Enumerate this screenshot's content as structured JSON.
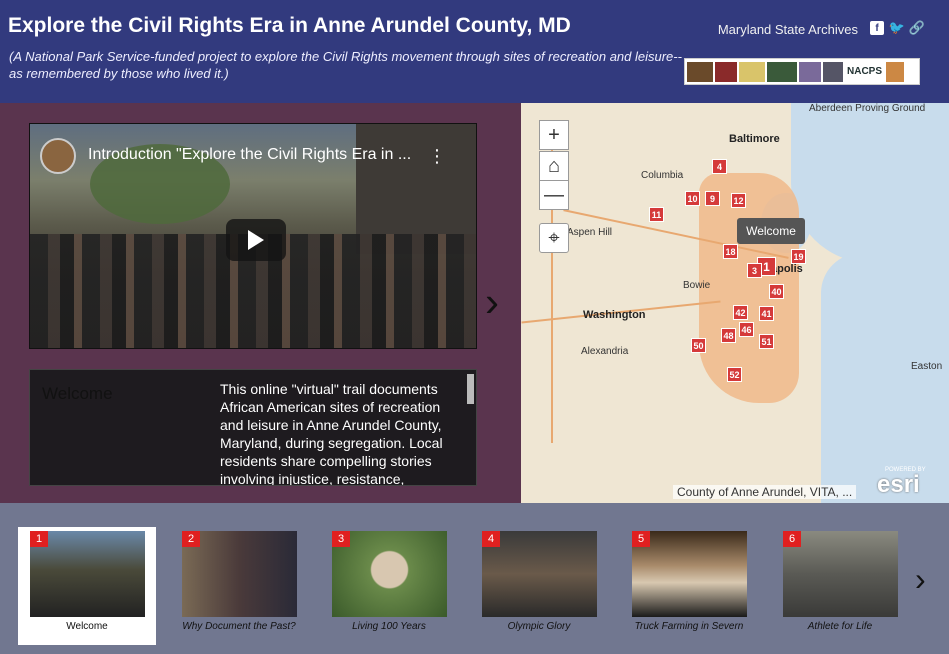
{
  "header": {
    "title": "Explore the Civil Rights Era in Anne Arundel County, MD",
    "subtitle": "(A National Park Service-funded project to explore the Civil Rights movement through sites of recreation and leisure--as remembered by those who lived it.)",
    "org_link": "Maryland State Archives",
    "logos_label": "NACPS",
    "share_icons": [
      "facebook-icon",
      "twitter-icon",
      "link-icon"
    ]
  },
  "video": {
    "title": "Introduction \"Explore the Civil Rights Era in ...",
    "menu": "⋮"
  },
  "panel": {
    "title": "Welcome",
    "text": "This online \"virtual\" trail documents African American sites of recreation and leisure in Anne Arundel County, Maryland, during segregation. Local residents share compelling stories involving injustice, resistance, sacrifice."
  },
  "map": {
    "zoom_in": "+",
    "zoom_out": "—",
    "tooltip": "Welcome",
    "attribution": "County of Anne Arundel, VITA, ...",
    "esri": "esri",
    "powered_by": "POWERED BY",
    "places": [
      "Baltimore",
      "Columbia",
      "Aspen Hill",
      "Washington",
      "Alexandria",
      "Bowie",
      "Easton",
      "Aberdeen Proving Ground",
      "apolis"
    ],
    "markers": [
      "4",
      "10",
      "9",
      "12",
      "11",
      "18",
      "1",
      "3",
      "19",
      "40",
      "42",
      "41",
      "46",
      "48",
      "50",
      "51",
      "52"
    ]
  },
  "carousel": {
    "items": [
      {
        "num": "1",
        "label": "Welcome"
      },
      {
        "num": "2",
        "label": "Why Document the Past?"
      },
      {
        "num": "3",
        "label": "Living 100 Years"
      },
      {
        "num": "4",
        "label": "Olympic Glory"
      },
      {
        "num": "5",
        "label": "Truck Farming in Severn"
      },
      {
        "num": "6",
        "label": "Athlete for Life"
      }
    ]
  },
  "colors": {
    "header": "#323a7e",
    "panel": "#5a344e",
    "marker": "#d53a3a",
    "carousel": "#717790"
  }
}
